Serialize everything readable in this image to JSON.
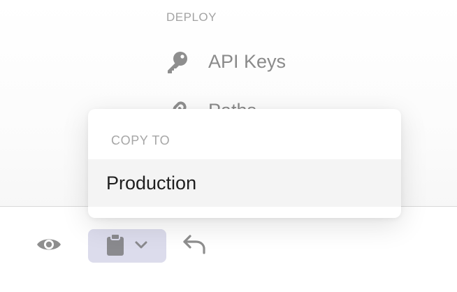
{
  "sidebar": {
    "section_header": "DEPLOY",
    "items": [
      {
        "label": "API Keys",
        "icon": "key-icon"
      },
      {
        "label": "Paths",
        "icon": "link-icon"
      }
    ]
  },
  "popover": {
    "title": "COPY TO",
    "options": [
      {
        "label": "Production"
      }
    ]
  },
  "toolbar": {
    "buttons": [
      {
        "icon": "eye-icon"
      },
      {
        "icon": "clipboard-icon",
        "secondary_icon": "chevron-down-icon"
      },
      {
        "icon": "undo-icon"
      }
    ]
  },
  "colors": {
    "accent_button_bg": "#dcdcec",
    "icon_gray": "#8e8e8e",
    "popover_option_bg": "#f4f4f4"
  }
}
